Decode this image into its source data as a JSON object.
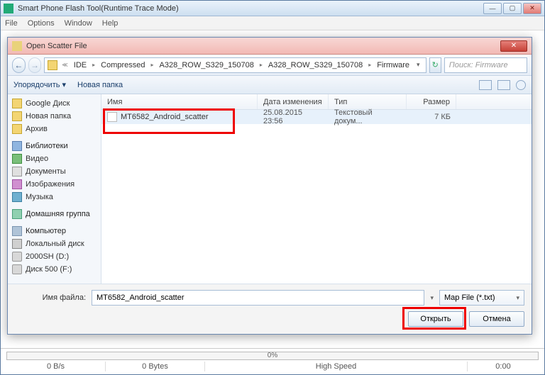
{
  "app": {
    "title": "Smart Phone Flash Tool(Runtime Trace Mode)",
    "menu": [
      "File",
      "Options",
      "Window",
      "Help"
    ]
  },
  "dialog": {
    "title": "Open Scatter File",
    "breadcrumb": [
      "IDE",
      "Compressed",
      "A328_ROW_S329_150708",
      "A328_ROW_S329_150708",
      "Firmware"
    ],
    "search_placeholder": "Поиск: Firmware",
    "toolbar": {
      "organize": "Упорядочить ▾",
      "new_folder": "Новая папка"
    },
    "columns": {
      "name": "Имя",
      "date": "Дата изменения",
      "type": "Тип",
      "size": "Размер"
    },
    "file": {
      "name": "MT6582_Android_scatter",
      "date": "25.08.2015 23:56",
      "type": "Текстовый докум...",
      "size": "7 КБ"
    },
    "sidebar": {
      "google_disk": "Google Диск",
      "new_folder": "Новая папка",
      "archive": "Архив",
      "libraries": "Библиотеки",
      "video": "Видео",
      "documents": "Документы",
      "images": "Изображения",
      "music": "Музыка",
      "homegroup": "Домашняя группа",
      "computer": "Компьютер",
      "local_disk": "Локальный диск",
      "drive_d": "2000SH  (D:)",
      "drive_f": "Диск 500 (F:)"
    },
    "filename_label": "Имя файла:",
    "filename_value": "MT6582_Android_scatter",
    "filter": "Map File (*.txt)",
    "open": "Открыть",
    "cancel": "Отмена"
  },
  "status": {
    "pct": "0%",
    "speed": "0 B/s",
    "bytes": "0 Bytes",
    "mode": "High Speed",
    "time": "0:00"
  }
}
